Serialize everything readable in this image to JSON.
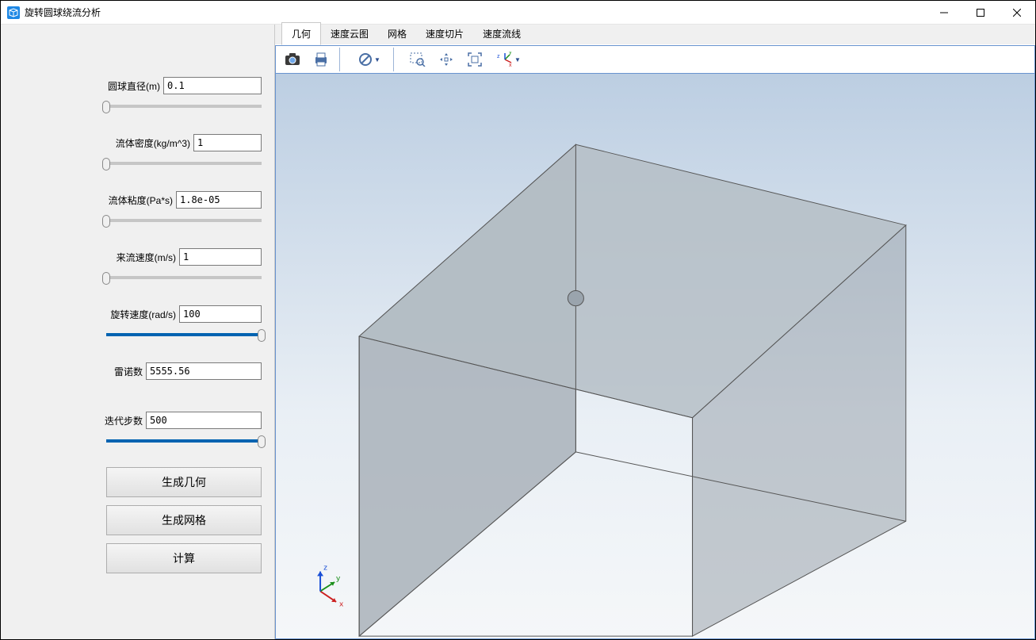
{
  "window": {
    "title": "旋转圆球绕流分析"
  },
  "sidebar": {
    "params": [
      {
        "label": "圆球直径(m)",
        "value": "0.1",
        "input_w": "w124",
        "slider_pct": 0
      },
      {
        "label": "流体密度(kg/m^3)",
        "value": "1",
        "input_w": "w86",
        "slider_pct": 0
      },
      {
        "label": "流体粘度(Pa*s)",
        "value": "1.8e-05",
        "input_w": "w108",
        "slider_pct": 0
      },
      {
        "label": "来流速度(m/s)",
        "value": "1",
        "input_w": "w104",
        "slider_pct": 0
      },
      {
        "label": "旋转速度(rad/s)",
        "value": "100",
        "input_w": "w104",
        "slider_pct": 100
      }
    ],
    "reynolds": {
      "label": "雷诺数",
      "value": "5555.56",
      "input_w": "w146"
    },
    "iterations": {
      "label": "迭代步数",
      "value": "500",
      "input_w": "w146",
      "slider_pct": 100
    },
    "buttons": {
      "generate_geometry": "生成几何",
      "generate_mesh": "生成网格",
      "compute": "计算"
    }
  },
  "tabs": {
    "items": [
      {
        "label": "几何",
        "active": true
      },
      {
        "label": "速度云图",
        "active": false
      },
      {
        "label": "网格",
        "active": false
      },
      {
        "label": "速度切片",
        "active": false
      },
      {
        "label": "速度流线",
        "active": false
      }
    ]
  },
  "toolbar": {
    "items": [
      {
        "name": "camera-icon",
        "sep_after": false
      },
      {
        "name": "print-icon",
        "sep_after": true
      },
      {
        "name": "no-symbol-icon",
        "sep_after": true,
        "dropdown": true
      },
      {
        "name": "zoom-rect-icon",
        "sep_after": false
      },
      {
        "name": "pan-icon",
        "sep_after": false
      },
      {
        "name": "zoom-fit-icon",
        "sep_after": false
      },
      {
        "name": "axes-xyz-icon",
        "sep_after": false,
        "dropdown": true
      }
    ]
  },
  "axes_label": {
    "x": "x",
    "y": "y",
    "z": "z"
  }
}
